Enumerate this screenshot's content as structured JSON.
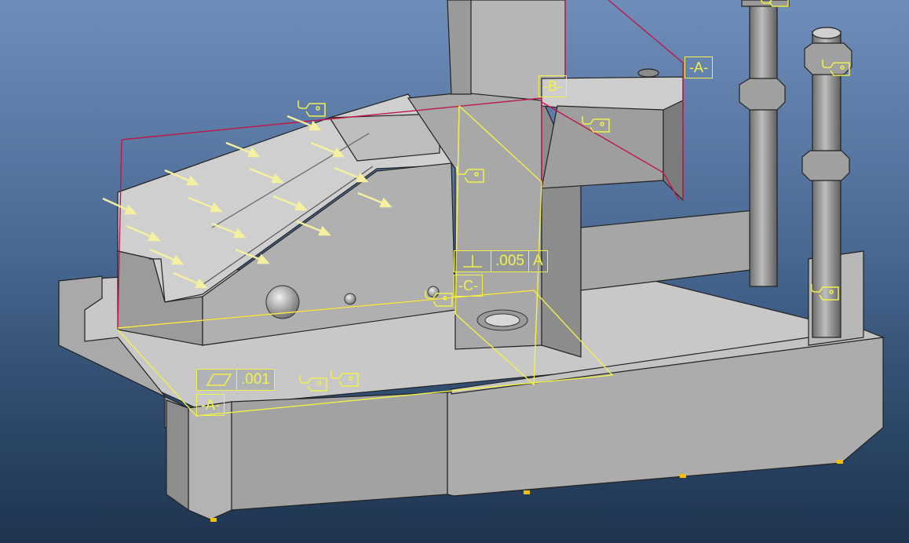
{
  "annotations": {
    "flatness_frame": {
      "symbol_icon": "flatness-icon",
      "tolerance": ".001"
    },
    "perpendicularity_frame": {
      "symbol_icon": "perpendicularity-icon",
      "tolerance": ".005",
      "datum_ref": "A"
    },
    "datum_labels": {
      "a_bottom": "-A-",
      "a_top": "-A-",
      "b": "-B-",
      "c": "-C-"
    }
  },
  "colors": {
    "background_top": "#6f8db9",
    "background_bottom": "#1f3450",
    "annotation": "#f2f04a",
    "datum_plane": "#c0184a",
    "load_arrow": "#f4f0a0",
    "part_face_light": "#d2d2d2",
    "part_face_mid": "#b4b4b4",
    "part_face_dark": "#8e8e8e"
  },
  "icons": [
    "tag-icon",
    "load-arrow-icon",
    "flatness-icon",
    "perpendicularity-icon"
  ]
}
